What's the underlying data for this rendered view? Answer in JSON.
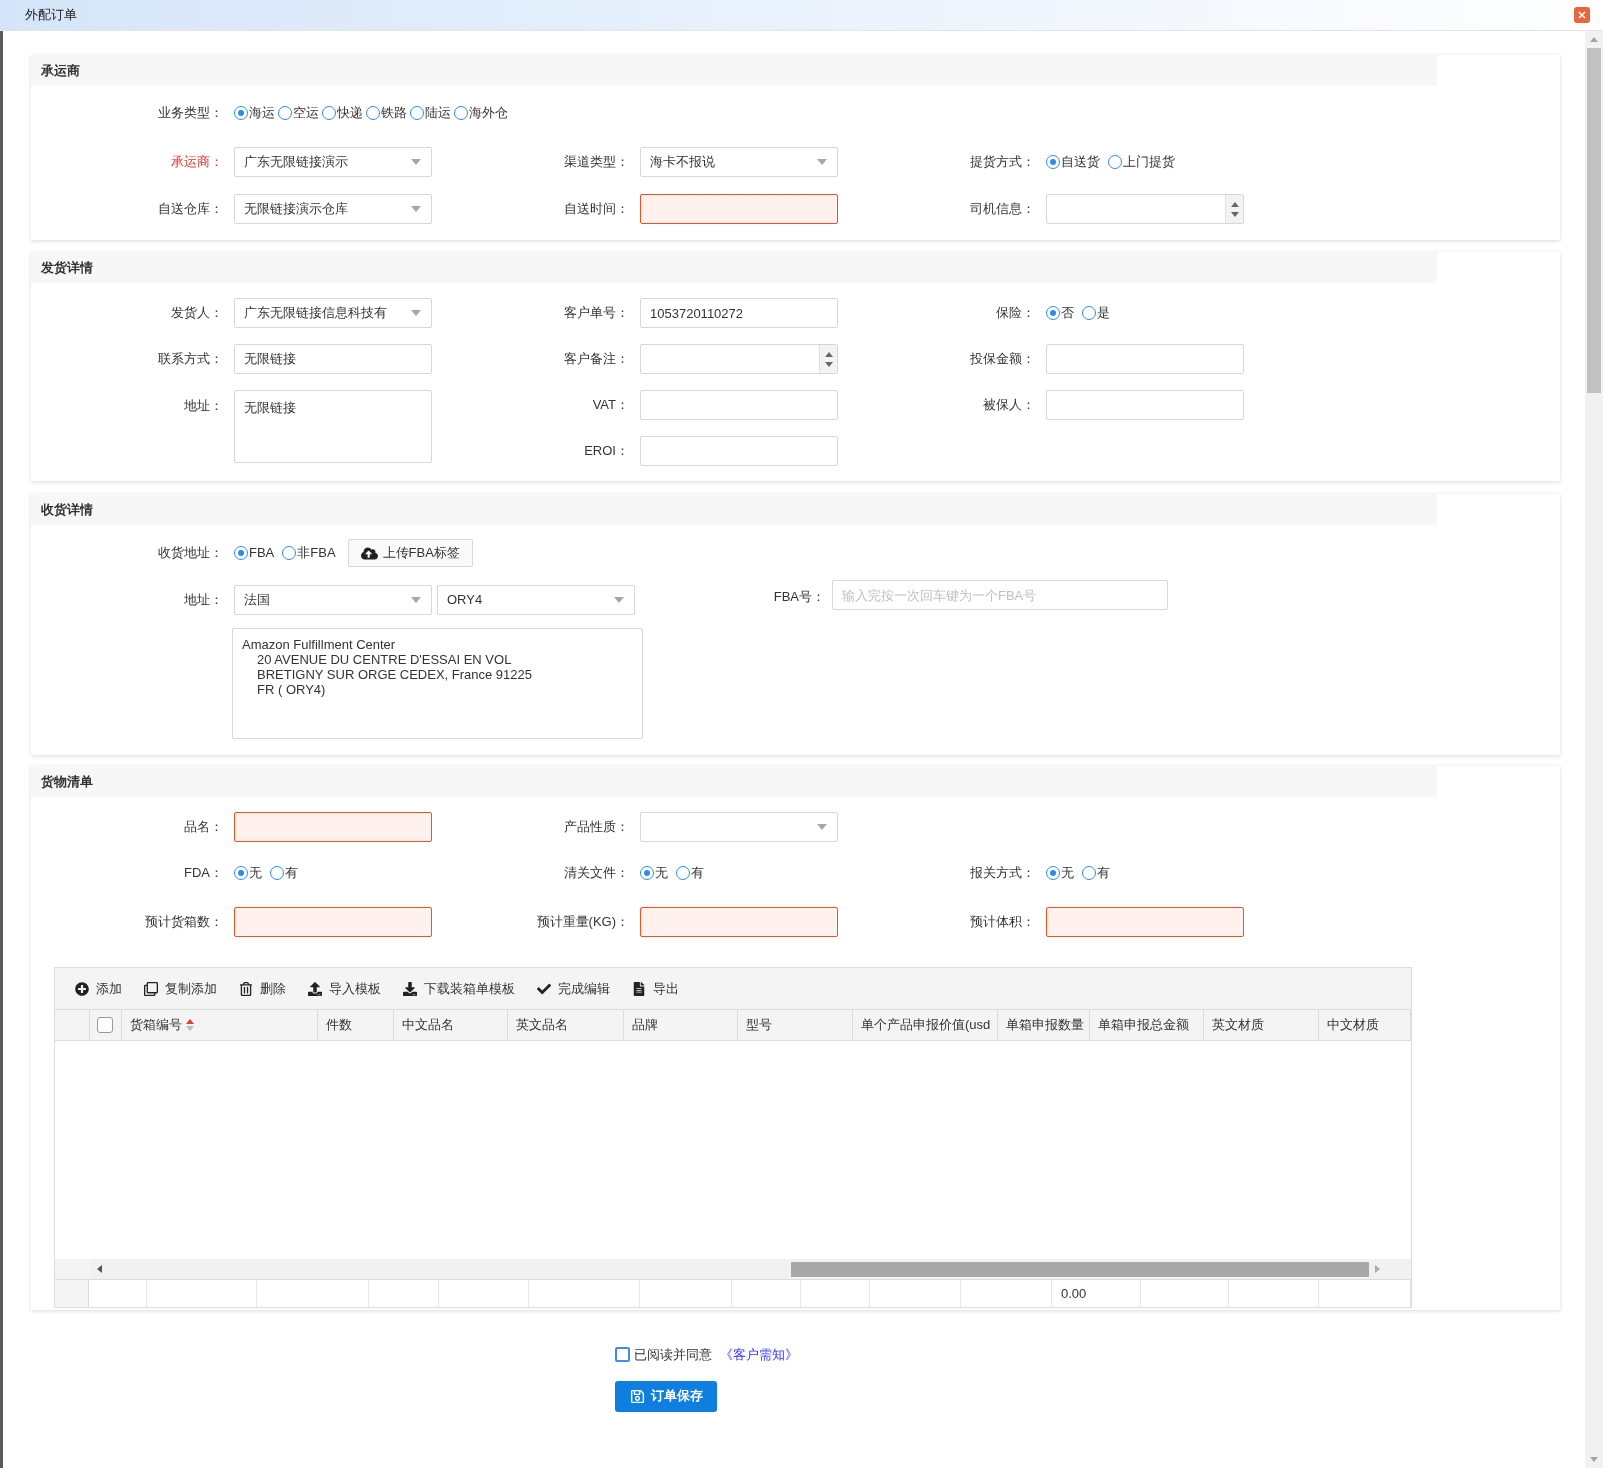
{
  "window": {
    "title": "外配订单"
  },
  "carrier_section": {
    "title": "承运商",
    "business_type": {
      "label": "业务类型：",
      "options": [
        {
          "label": "海运",
          "selected": true
        },
        {
          "label": "空运",
          "selected": false
        },
        {
          "label": "快递",
          "selected": false
        },
        {
          "label": "铁路",
          "selected": false
        },
        {
          "label": "陆运",
          "selected": false
        },
        {
          "label": "海外仓",
          "selected": false
        }
      ]
    },
    "carrier": {
      "label": "承运商：",
      "required": true,
      "value": "广东无限链接演示"
    },
    "channel_type": {
      "label": "渠道类型：",
      "value": "海卡不报说"
    },
    "pickup_method": {
      "label": "提货方式：",
      "options": [
        {
          "label": "自送货",
          "selected": true
        },
        {
          "label": "上门提货",
          "selected": false
        }
      ]
    },
    "warehouse": {
      "label": "自送仓库：",
      "value": "无限链接演示仓库"
    },
    "send_time": {
      "label": "自送时间：",
      "invalid": true
    },
    "driver_info": {
      "label": "司机信息："
    }
  },
  "shipping_section": {
    "title": "发货详情",
    "shipper": {
      "label": "发货人：",
      "value": "广东无限链接信息科技有"
    },
    "contact": {
      "label": "联系方式：",
      "value": "无限链接"
    },
    "address": {
      "label": "地址：",
      "value": "无限链接"
    },
    "customer_no": {
      "label": "客户单号：",
      "value": "1053720110272"
    },
    "customer_note": {
      "label": "客户备注："
    },
    "vat": {
      "label": "VAT："
    },
    "eori": {
      "label": "EROI："
    },
    "insurance": {
      "label": "保险：",
      "options": [
        {
          "label": "否",
          "selected": true
        },
        {
          "label": "是",
          "selected": false
        }
      ]
    },
    "insured_amount": {
      "label": "投保金额："
    },
    "insured_person": {
      "label": "被保人："
    }
  },
  "receiving_section": {
    "title": "收货详情",
    "receive_address": {
      "label": "收货地址：",
      "options": [
        {
          "label": "FBA",
          "selected": true
        },
        {
          "label": "非FBA",
          "selected": false
        }
      ]
    },
    "upload_button": "上传FBA标签",
    "address": {
      "label": "地址：",
      "country": "法国",
      "warehouse_code": "ORY4"
    },
    "address_text": [
      "Amazon Fulfillment Center",
      "20 AVENUE DU CENTRE D'ESSAI EN VOL",
      "BRETIGNY SUR ORGE CEDEX, France 91225",
      "FR ( ORY4)"
    ],
    "fba_no": {
      "label": "FBA号：",
      "placeholder": "输入完按一次回车键为一个FBA号"
    }
  },
  "goods_section": {
    "title": "货物清单",
    "product_name": {
      "label": "品名：",
      "invalid": true
    },
    "product_nature": {
      "label": "产品性质："
    },
    "fda": {
      "label": "FDA：",
      "options": [
        {
          "label": "无",
          "selected": true
        },
        {
          "label": "有",
          "selected": false
        }
      ]
    },
    "customs_docs": {
      "label": "清关文件：",
      "options": [
        {
          "label": "无",
          "selected": true
        },
        {
          "label": "有",
          "selected": false
        }
      ]
    },
    "declaration": {
      "label": "报关方式：",
      "options": [
        {
          "label": "无",
          "selected": true
        },
        {
          "label": "有",
          "selected": false
        }
      ]
    },
    "box_count": {
      "label": "预计货箱数：",
      "invalid": true
    },
    "weight": {
      "label": "预计重量(KG)：",
      "invalid": true
    },
    "volume": {
      "label": "预计体积：",
      "invalid": true
    },
    "table": {
      "toolbar": [
        {
          "label": "添加"
        },
        {
          "label": "复制添加"
        },
        {
          "label": "删除"
        },
        {
          "label": "导入模板"
        },
        {
          "label": "下载装箱单模板"
        },
        {
          "label": "完成编辑"
        },
        {
          "label": "导出"
        }
      ],
      "select_all_checked": false,
      "columns": [
        {
          "label": "货箱编号",
          "sorted_ascending": true
        },
        {
          "label": "件数"
        },
        {
          "label": "中文品名"
        },
        {
          "label": "英文品名"
        },
        {
          "label": "品牌"
        },
        {
          "label": "型号"
        },
        {
          "label": "单个产品申报价值(usd"
        },
        {
          "label": "单箱申报数量"
        },
        {
          "label": "单箱申报总金额"
        },
        {
          "label": "英文材质"
        },
        {
          "label": "中文材质"
        }
      ],
      "footer_total": "0.00"
    }
  },
  "agreement": {
    "checked": false,
    "text": "已阅读并同意",
    "link": "《客户需知》"
  },
  "save_button": "订单保存"
}
